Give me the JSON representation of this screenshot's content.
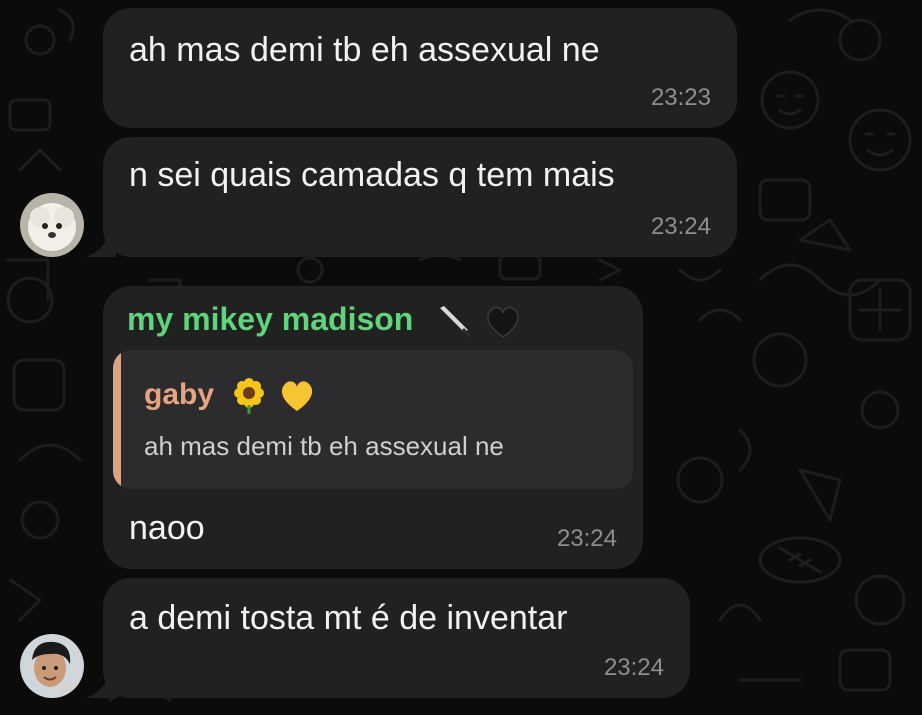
{
  "messages": [
    {
      "text": "ah mas demi tb eh assexual ne",
      "time": "23:23"
    },
    {
      "text": "n sei quais camadas q tem mais",
      "time": "23:24"
    },
    {
      "sender": "my mikey madison",
      "sender_emojis": [
        "knife",
        "black-heart"
      ],
      "quote": {
        "name": "gaby",
        "name_emojis": [
          "sunflower",
          "yellow-heart"
        ],
        "text": "ah mas demi tb eh assexual ne"
      },
      "text": "naoo",
      "time": "23:24"
    },
    {
      "text": "a demi tosta mt é de inventar",
      "time": "23:24"
    }
  ],
  "colors": {
    "background": "#0b0b0c",
    "bubble": "#212121",
    "sender_name": "#5fd47a",
    "quote_accent": "#d9a483",
    "timestamp": "#8e8e93"
  }
}
